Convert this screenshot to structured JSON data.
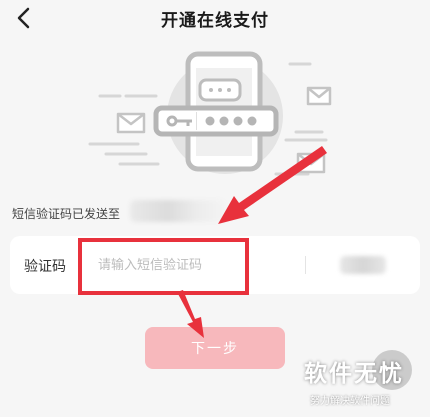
{
  "header": {
    "title": "开通在线支付",
    "back_icon": "chevron-left-icon"
  },
  "sms_notice": {
    "text": "短信验证码已发送至"
  },
  "verification": {
    "label": "验证码",
    "placeholder": "请输入短信验证码",
    "value": ""
  },
  "next_button": {
    "label": "下一步"
  },
  "watermark": {
    "main": "软件无忧",
    "sub": "努力解决软件问题"
  },
  "colors": {
    "accent": "#e8313c",
    "button_disabled": "#f7b8bc",
    "background": "#f6f6f6",
    "illustration_gray": "#b5b5b5"
  }
}
